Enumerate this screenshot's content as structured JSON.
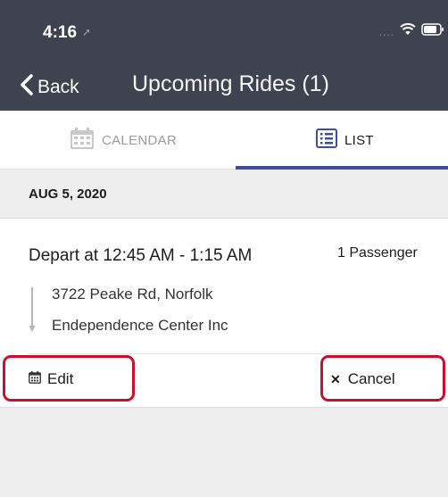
{
  "status_bar": {
    "time": "4:16",
    "location_glyph": "➚",
    "signal": "....",
    "icons": [
      "wifi-icon",
      "battery-icon"
    ]
  },
  "nav": {
    "back_label": "Back",
    "title": "Upcoming Rides (1)"
  },
  "tabs": [
    {
      "label": "CALENDAR",
      "icon": "calendar-icon",
      "selected": false
    },
    {
      "label": "LIST",
      "icon": "list-icon",
      "selected": true
    }
  ],
  "rides": {
    "date": "AUG 5, 2020",
    "depart": "Depart at 12:45 AM - 1:15 AM",
    "passengers": "1 Passenger",
    "origin": "3722 Peake Rd, Norfolk",
    "destination": "Endependence Center Inc",
    "edit_label": "Edit",
    "cancel_label": "Cancel"
  },
  "colors": {
    "header": "#3f4350",
    "accent": "#3d4f9a",
    "highlight": "#c8102e",
    "background": "#eeeeee"
  }
}
